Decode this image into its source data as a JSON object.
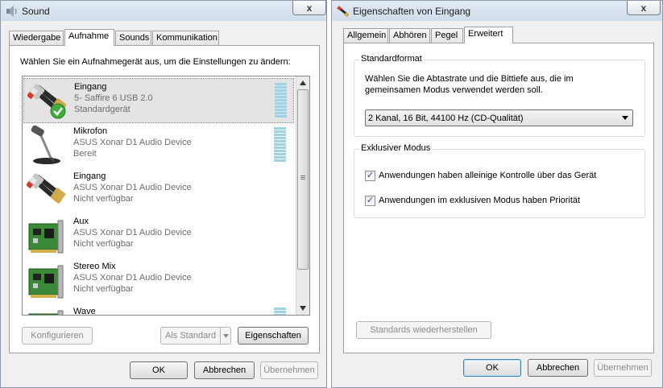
{
  "sound": {
    "title": "Sound",
    "close_glyph": "x",
    "tabs": [
      "Wiedergabe",
      "Aufnahme",
      "Sounds",
      "Kommunikation"
    ],
    "active_tab_index": 1,
    "instruction": "Wählen Sie ein Aufnahmegerät aus, um die Einstellungen zu ändern:",
    "devices": [
      {
        "name": "Eingang",
        "device": "5- Saffire 6 USB 2.0",
        "status": "Standardgerät",
        "icon": "rca-cable-icon",
        "selected": true,
        "default": true
      },
      {
        "name": "Mikrofon",
        "device": "ASUS Xonar D1 Audio Device",
        "status": "Bereit",
        "icon": "microphone-icon"
      },
      {
        "name": "Eingang",
        "device": "ASUS Xonar D1 Audio Device",
        "status": "Nicht verfügbar",
        "icon": "rca-cable-icon"
      },
      {
        "name": "Aux",
        "device": "ASUS Xonar D1 Audio Device",
        "status": "Nicht verfügbar",
        "icon": "sound-card-icon"
      },
      {
        "name": "Stereo Mix",
        "device": "ASUS Xonar D1 Audio Device",
        "status": "Nicht verfügbar",
        "icon": "sound-card-icon"
      },
      {
        "name": "Wave",
        "device": "",
        "status": "",
        "icon": "sound-card-icon"
      }
    ],
    "buttons": {
      "configure": "Konfigurieren",
      "set_default": "Als Standard",
      "properties": "Eigenschaften",
      "ok": "OK",
      "cancel": "Abbrechen",
      "apply": "Übernehmen"
    }
  },
  "props": {
    "title": "Eigenschaften von Eingang",
    "close_glyph": "x",
    "tabs": [
      "Allgemein",
      "Abhören",
      "Pegel",
      "Erweitert"
    ],
    "active_tab_index": 3,
    "format_group": {
      "title": "Standardformat",
      "description": "Wählen Sie die Abtastrate und die Bittiefe aus, die im gemeinsamen Modus verwendet werden soll.",
      "selected": "2 Kanal, 16 Bit, 44100 Hz (CD-Qualität)"
    },
    "exclusive_group": {
      "title": "Exklusiver Modus",
      "options": [
        {
          "label": "Anwendungen haben alleinige Kontrolle über das Gerät",
          "checked": true
        },
        {
          "label": "Anwendungen im exklusiven Modus haben Priorität",
          "checked": true
        }
      ]
    },
    "buttons": {
      "restore_defaults": "Standards wiederherstellen",
      "ok": "OK",
      "cancel": "Abbrechen",
      "apply": "Übernehmen"
    }
  }
}
